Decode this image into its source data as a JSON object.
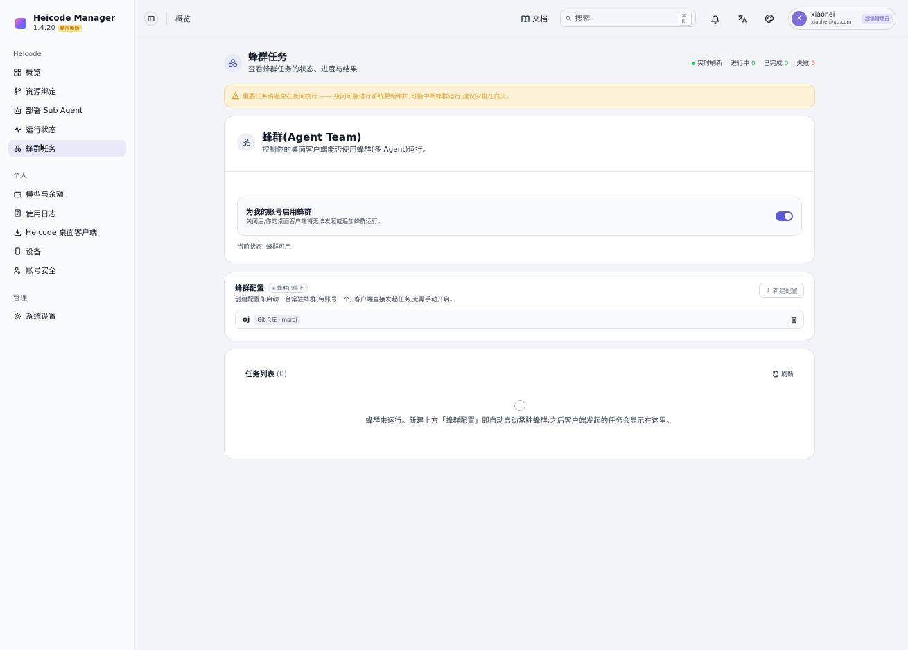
{
  "brand": {
    "name": "Heicode Manager",
    "version": "1.4.20",
    "badge": "精简新版"
  },
  "sidebar": {
    "groups": [
      {
        "title": "Heicode",
        "items": [
          {
            "label": "概览",
            "icon": "grid-icon"
          },
          {
            "label": "资源绑定",
            "icon": "branch-icon"
          },
          {
            "label": "部署 Sub Agent",
            "icon": "bot-icon"
          },
          {
            "label": "运行状态",
            "icon": "activity-icon"
          },
          {
            "label": "蜂群任务",
            "icon": "swarm-icon",
            "active": true
          }
        ]
      },
      {
        "title": "个人",
        "items": [
          {
            "label": "模型与余额",
            "icon": "wallet-icon"
          },
          {
            "label": "使用日志",
            "icon": "log-icon"
          },
          {
            "label": "Heicode 桌面客户端",
            "icon": "download-icon"
          },
          {
            "label": "设备",
            "icon": "device-icon"
          },
          {
            "label": "账号安全",
            "icon": "user-key-icon"
          }
        ]
      },
      {
        "title": "管理",
        "items": [
          {
            "label": "系统设置",
            "icon": "gear-icon"
          }
        ]
      }
    ]
  },
  "topbar": {
    "breadcrumb": "概览",
    "docs_label": "文档",
    "search_placeholder": "搜索",
    "search_shortcut": "⌘ K",
    "user": {
      "avatar": "X",
      "name": "xiaohei",
      "email": "xiaohei@qq.com",
      "role": "超级管理员"
    }
  },
  "page": {
    "title": "蜂群任务",
    "subtitle": "查看蜂群任务的状态、进度与结果",
    "stats": {
      "live_label": "实时刷新",
      "running_label": "进行中",
      "running": "0",
      "done_label": "已完成",
      "done": "0",
      "failed_label": "失败",
      "failed": "0"
    },
    "alert": "重要任务请避免在夜间执行 —— 夜间可能进行系统更新维护,可能中断蜂群运行,建议安排在白天。"
  },
  "team_card": {
    "title": "蜂群(Agent Team)",
    "subtitle": "控制你的桌面客户端能否使用蜂群(多 Agent)运行。",
    "enable_title": "为我的账号启用蜂群",
    "enable_sub": "关闭后,你的桌面客户端将无法发起或追加蜂群运行。",
    "enabled": true,
    "status": "当前状态: 蜂群可用"
  },
  "config_card": {
    "title": "蜂群配置",
    "status_pill": "蜂群已停止",
    "subtitle": "创建配置即启动一台常驻蜂群(每账号一个);客户端直接发起任务,无需手动开启。",
    "new_button": "新建配置",
    "items": [
      {
        "name": "oj",
        "tag": "Git 仓库 · mproj"
      }
    ]
  },
  "tasks_card": {
    "title": "任务列表",
    "count": "(0)",
    "refresh_label": "刷新",
    "empty": "蜂群未运行。新建上方「蜂群配置」即自动启动常驻蜂群;之后客户端发起的任务会显示在这里。"
  },
  "colors": {
    "accent": "#5b5bd6",
    "active_bg": "#e8eafa",
    "warn_bg": "#fdf1d8",
    "warn_text": "#e0a127",
    "success": "#22c55e",
    "danger": "#ef4444"
  }
}
